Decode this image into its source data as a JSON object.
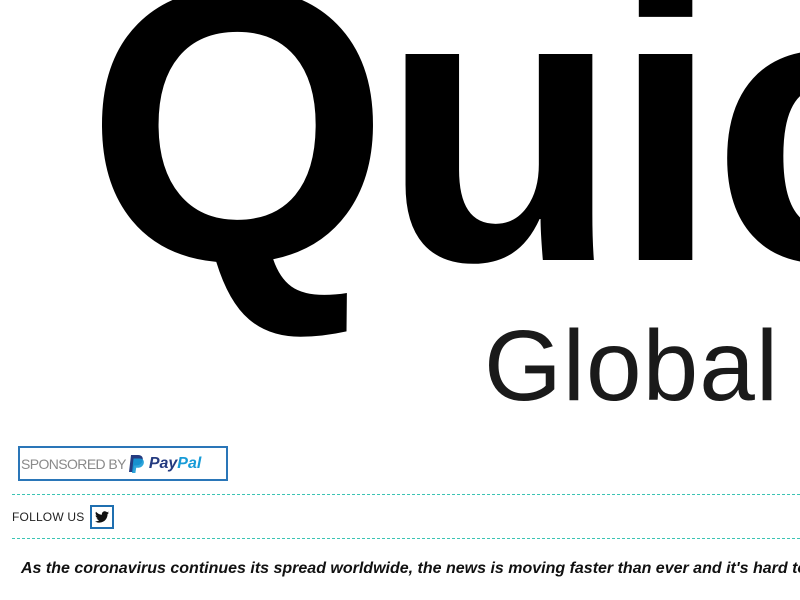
{
  "logo": {
    "main_text": "Quic",
    "sub_text": "Global"
  },
  "sponsor": {
    "label": "SPONSORED BY",
    "brand_part1": "Pay",
    "brand_part2": "Pal",
    "icon": "paypal-icon",
    "colors": {
      "border": "#2a76b8",
      "pay": "#253b80",
      "pal": "#179bd7"
    }
  },
  "follow": {
    "label": "FOLLOW US",
    "icon": "twitter-icon"
  },
  "divider_color": "#3cc4b4",
  "article": {
    "intro": "As the coronavirus continues its spread worldwide, the news is moving faster than ever and it's hard to k"
  }
}
